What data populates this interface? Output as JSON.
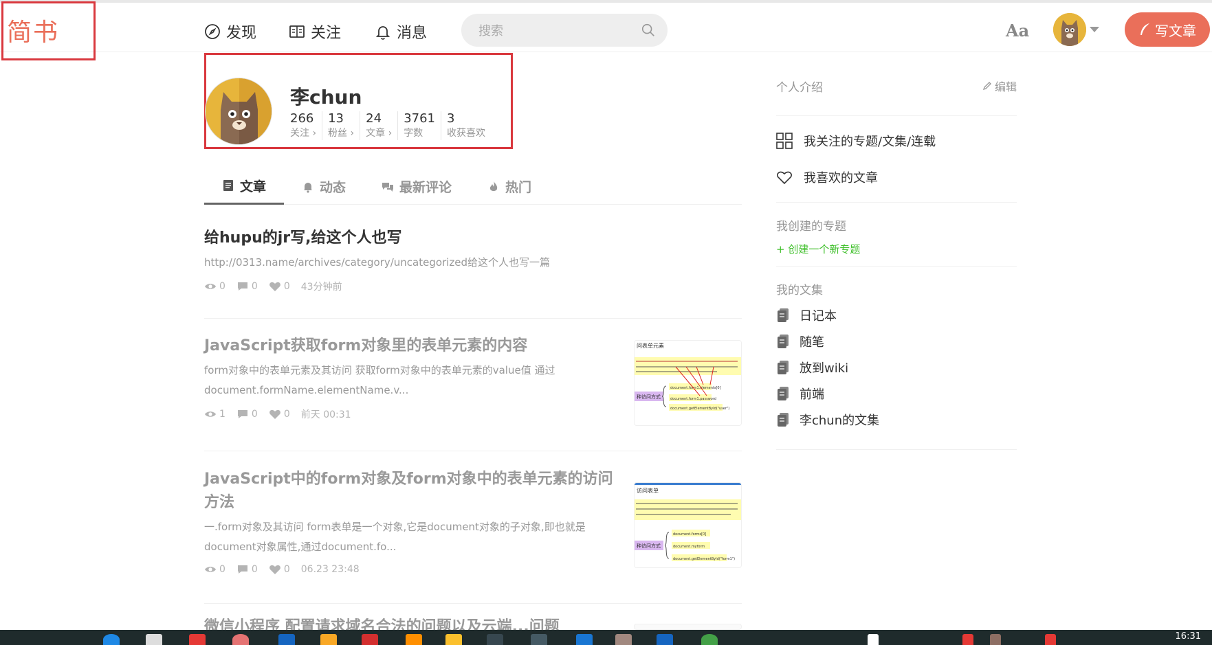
{
  "app": {
    "logo": "简书"
  },
  "nav": {
    "discover": "发现",
    "follow": "关注",
    "messages": "消息",
    "search_placeholder": "搜索",
    "font_toggle": "Aa",
    "write": "写文章"
  },
  "profile": {
    "name": "李chun",
    "stats": [
      {
        "num": "266",
        "label": "关注 ›"
      },
      {
        "num": "13",
        "label": "粉丝 ›"
      },
      {
        "num": "24",
        "label": "文章 ›"
      },
      {
        "num": "3761",
        "label": "字数"
      },
      {
        "num": "3",
        "label": "收获喜欢"
      }
    ]
  },
  "tabs": [
    {
      "label": "文章",
      "icon": "article-icon",
      "active": true
    },
    {
      "label": "动态",
      "icon": "bell-icon",
      "active": false
    },
    {
      "label": "最新评论",
      "icon": "comments-icon",
      "active": false
    },
    {
      "label": "热门",
      "icon": "fire-icon",
      "active": false
    }
  ],
  "articles": [
    {
      "title": "给hupu的jr写,给这个人也写",
      "abstract": "http://0313.name/archives/category/uncategorized给这个人也写一篇",
      "views": "0",
      "comments": "0",
      "likes": "0",
      "time": "43分钟前"
    },
    {
      "title": "JavaScript获取form对象里的表单元素的内容",
      "abstract": "form对象中的表单元素及其访问 获取form对象中的表单元素的value值 通过document.formName.elementName.v...",
      "views": "1",
      "comments": "0",
      "likes": "0",
      "time": "前天 00:31"
    },
    {
      "title": "JavaScript中的form对象及form对象中的表单元素的访问方法",
      "abstract": "一.form对象及其访问 form表单是一个对象,它是document对象的子对象,即也就是document对象属性,通过document.fo...",
      "views": "0",
      "comments": "0",
      "likes": "0",
      "time": "06.23 23:48"
    },
    {
      "title": "微信小程序 配置请求域名合法的问题以及云端...问题",
      "abstract": "",
      "views": "",
      "comments": "",
      "likes": "",
      "time": ""
    }
  ],
  "thumbs": {
    "t1_title": "问表单元素",
    "t1_label": "种访问方式",
    "t1_lines": [
      "document.form1.elements[0]",
      "document.form1.password",
      "document.getElementById(\"user\")"
    ],
    "t2_title": "访问表单",
    "t2_label": "种访问方式",
    "t2_lines": [
      "document.forms[0]",
      "document.myform",
      "document.getElementById(\"form1\")"
    ]
  },
  "sidebar": {
    "intro": "个人介绍",
    "edit": "编辑",
    "links": [
      {
        "label": "我关注的专题/文集/连载",
        "icon": "grid-icon"
      },
      {
        "label": "我喜欢的文章",
        "icon": "heart-icon"
      }
    ],
    "created_topics": "我创建的专题",
    "create_topic": "+ 创建一个新专题",
    "my_collections": "我的文集",
    "books": [
      "日记本",
      "随笔",
      "放到wiki",
      "前端",
      "李chun的文集"
    ]
  },
  "taskbar": {
    "clock": "16:31"
  },
  "colors": {
    "brand": "#ea6f5a",
    "green": "#42c02e",
    "highlight_box": "#d9383e"
  }
}
